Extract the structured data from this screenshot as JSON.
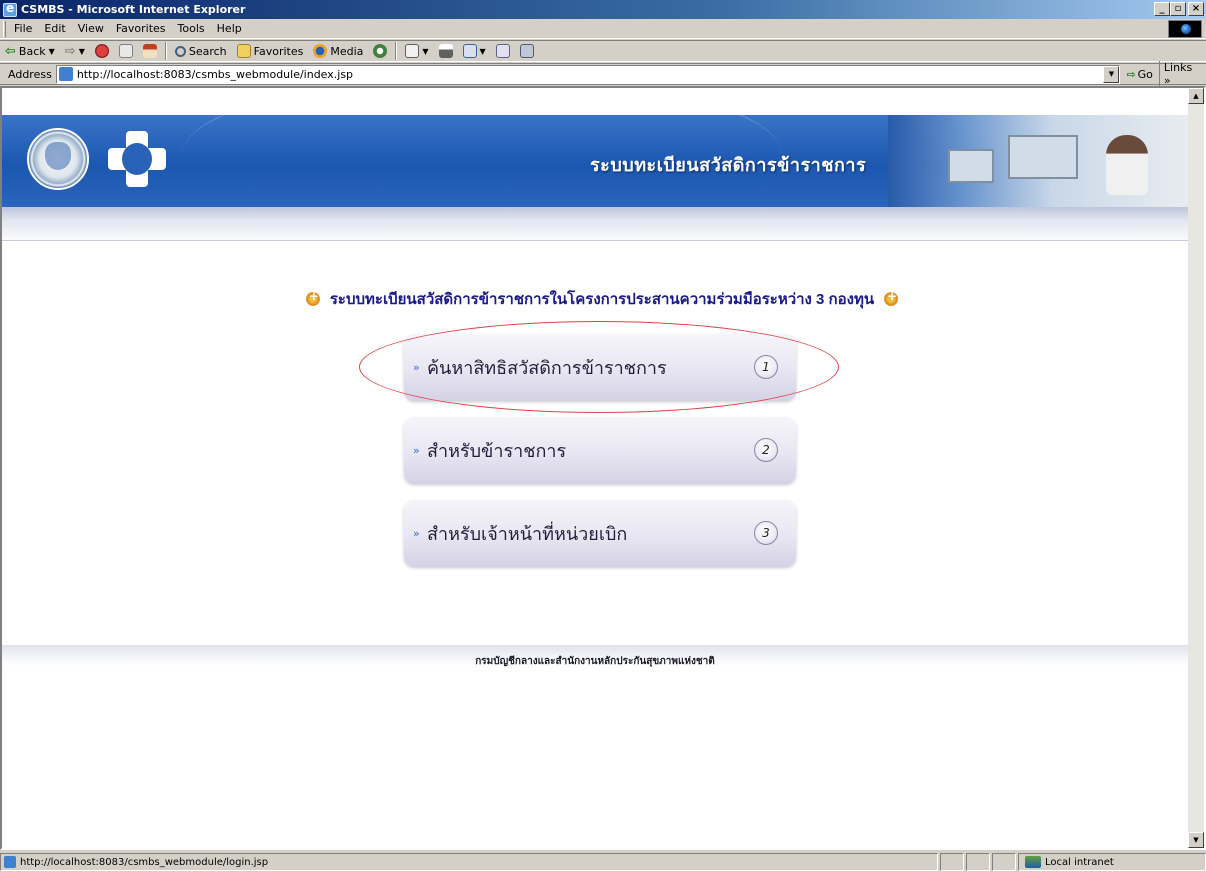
{
  "window": {
    "title": "CSMBS - Microsoft Internet Explorer",
    "min_glyph": "_",
    "max_glyph": "▫",
    "close_glyph": "×"
  },
  "menubar": [
    "File",
    "Edit",
    "View",
    "Favorites",
    "Tools",
    "Help"
  ],
  "toolbar": {
    "back_label": "Back",
    "search_label": "Search",
    "favorites_label": "Favorites",
    "media_label": "Media"
  },
  "address": {
    "label": "Address",
    "url": "http://localhost:8083/csmbs_webmodule/index.jsp",
    "go_label": "Go",
    "links_label": "Links »"
  },
  "page": {
    "banner_title": "ระบบทะเบียนสวัสดิการข้าราชการ",
    "heading": "ระบบทะเบียนสวัสดิการข้าราชการในโครงการประสานความร่วมมือระหว่าง 3 กองทุน",
    "menu": [
      {
        "label": "ค้นหาสิทธิสวัสดิการข้าราชการ",
        "number": "1"
      },
      {
        "label": "สำหรับข้าราชการ",
        "number": "2"
      },
      {
        "label": "สำหรับเจ้าหน้าที่หน่วยเบิก",
        "number": "3"
      }
    ],
    "footer": "กรมบัญชีกลางและสำนักงานหลักประกันสุขภาพแห่งชาติ"
  },
  "status": {
    "url": "http://localhost:8083/csmbs_webmodule/login.jsp",
    "zone": "Local intranet"
  }
}
